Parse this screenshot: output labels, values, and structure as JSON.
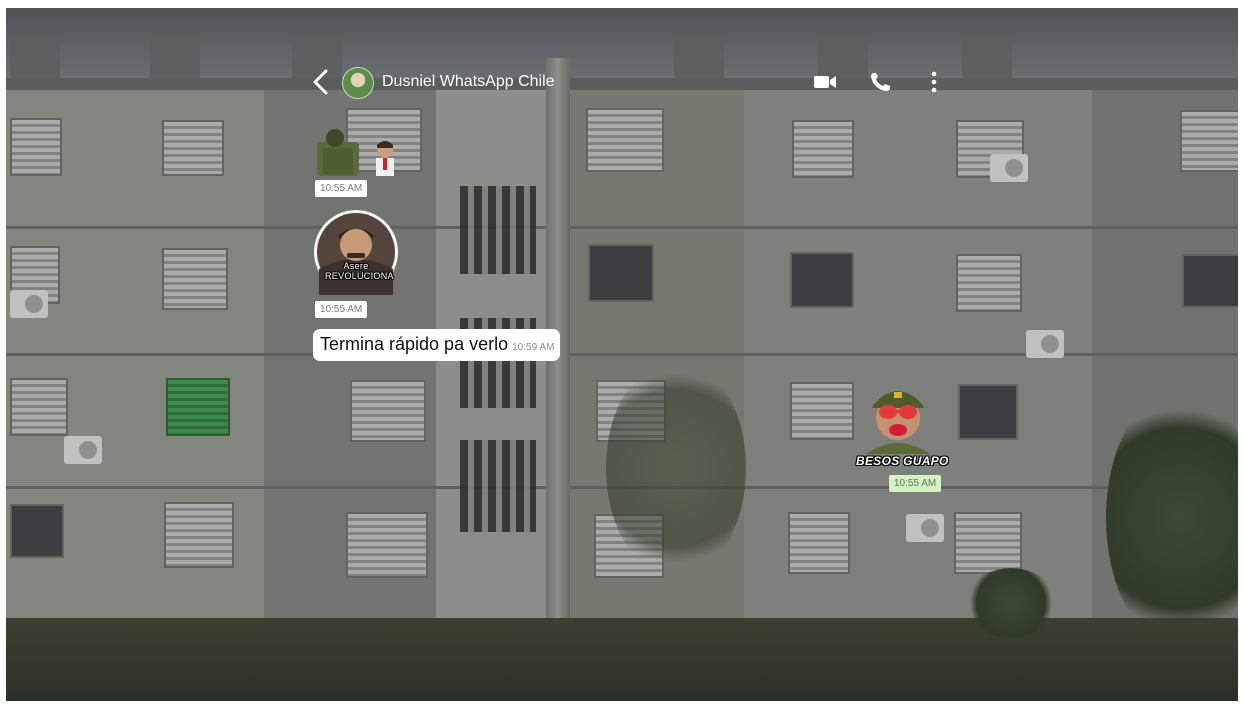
{
  "header": {
    "back_glyph": "‹",
    "contact_name": "Dusniel WhatsApp Chile",
    "icons": [
      "video-call-icon",
      "voice-call-icon",
      "more-options-icon"
    ]
  },
  "messages": [
    {
      "type": "sticker",
      "direction": "incoming",
      "time": "10:55 AM"
    },
    {
      "type": "sticker",
      "direction": "incoming",
      "caption": "Asere REVOLUCIONA",
      "time": "10:55 AM"
    },
    {
      "type": "text",
      "direction": "incoming",
      "text": "Termina rápido pa verlo",
      "time": "10:59 AM"
    },
    {
      "type": "sticker",
      "direction": "outgoing",
      "caption": "BESOS GUAPO",
      "time": "10:55 AM"
    }
  ],
  "colors": {
    "outgoing_time_bg": "#d4f4c4",
    "incoming_bubble_bg": "#ffffff"
  }
}
